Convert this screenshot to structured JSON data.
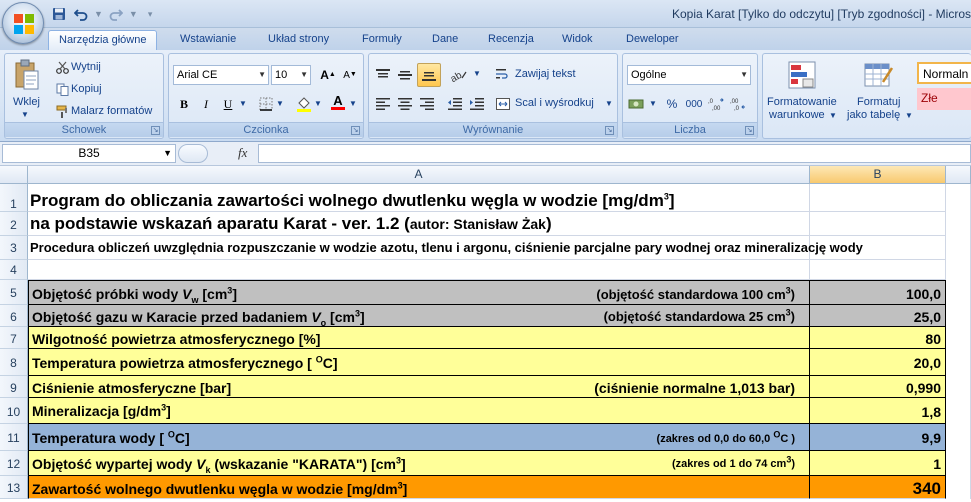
{
  "window": {
    "title": "Kopia Karat  [Tylko do odczytu]  [Tryb zgodności] - Micros"
  },
  "colors": {
    "gray": "#c0c0c0",
    "yellow": "#ffff99",
    "blue": "#95b3d7",
    "orange": "#ff9900"
  },
  "tabs": [
    "Narzędzia główne",
    "Wstawianie",
    "Układ strony",
    "Formuły",
    "Dane",
    "Recenzja",
    "Widok",
    "Deweloper"
  ],
  "ribbon": {
    "clipboard": {
      "paste": "Wklej",
      "cut": "Wytnij",
      "copy": "Kopiuj",
      "format_painter": "Malarz formatów",
      "label": "Schowek"
    },
    "font": {
      "name": "Arial CE",
      "size": "10",
      "label": "Czcionka",
      "bold": "B",
      "italic": "I",
      "underline": "U",
      "grow": "A",
      "shrink": "A",
      "color_letter": "A"
    },
    "alignment": {
      "wrap": "Zawijaj tekst",
      "merge": "Scal i wyśrodkuj",
      "label": "Wyrównanie"
    },
    "number": {
      "format": "Ogólne",
      "percent": "%",
      "thousands": "000",
      "label": "Liczba"
    },
    "styles": {
      "conditional": "Formatowanie",
      "conditional2": "warunkowe",
      "as_table": "Formatuj",
      "as_table2": "jako tabelę",
      "normal": "Normaln",
      "bad": "Złe"
    }
  },
  "formula_bar": {
    "name_box": "B35",
    "fx": "fx",
    "formula": ""
  },
  "columns": [
    "A",
    "B"
  ],
  "rows": [
    "1",
    "2",
    "3",
    "4",
    "5",
    "6",
    "7",
    "8",
    "9",
    "10",
    "11",
    "12",
    "13"
  ],
  "sheet": {
    "r1_title": "Program do obliczania zawartości wolnego dwutlenku węgla w wodzie [mg/dm",
    "r1_sup": "3",
    "r1_end": "]",
    "r2_a": "na podstawie wskazań aparatu Karat - ver. 1.2 (",
    "r2_b": "autor: Stanisław Żak",
    "r2_c": ")",
    "r3": "Procedura obliczeń uwzględnia rozpuszczanie w wodzie azotu, tlenu i argonu, ciśnienie parcjalne pary wodnej oraz mineralizację wody",
    "r5_a": "Objętość próbki wody ",
    "r5_var": "V",
    "r5_sub": "w",
    "r5_b": "  [cm",
    "r5_sup": "3",
    "r5_c": "]",
    "r5_note": "(objętość standardowa 100 cm",
    "r5_note_sup": "3",
    "r5_note_end": ")",
    "r5_val": "100,0",
    "r6_a": "Objętość gazu w Karacie przed badaniem ",
    "r6_var": "V",
    "r6_sub": "o",
    "r6_b": "  [cm",
    "r6_sup": "3",
    "r6_c": "]",
    "r6_note": "(objętość standardowa 25 cm",
    "r6_note_sup": "3",
    "r6_note_end": ")",
    "r6_val": "25,0",
    "r7_a": "Wilgotność powietrza atmosferycznego  [%]",
    "r7_val": "80",
    "r8_a": "Temperatura powietrza atmosferycznego  [ ",
    "r8_sup": "O",
    "r8_b": "C]",
    "r8_val": "20,0",
    "r9_a": "Ciśnienie atmosferyczne  [bar]",
    "r9_note": "(ciśnienie normalne 1,013 bar)",
    "r9_val": "0,990",
    "r10_a": "Mineralizacja [g/dm",
    "r10_sup": "3",
    "r10_b": "]",
    "r10_val": "1,8",
    "r11_a": "Temperatura wody  [ ",
    "r11_sup": "O",
    "r11_b": "C]",
    "r11_note": "(zakres od 0,0 do 60,0 ",
    "r11_note_sup": "O",
    "r11_note_end": "C )",
    "r11_val": "9,9",
    "r12_a": "Objętość wypartej wody ",
    "r12_var": "V",
    "r12_sub": "k",
    "r12_b": " (wskazanie \"KARATA\")  [cm",
    "r12_sup": "3",
    "r12_c": "]",
    "r12_note": "(zakres od 1 do 74 cm",
    "r12_note_sup": "3",
    "r12_note_end": ")",
    "r12_val": "1",
    "r13_a": "Zawartość wolnego dwutlenku węgla w wodzie  [mg/dm",
    "r13_sup": "3",
    "r13_b": "]",
    "r13_val": "340"
  }
}
